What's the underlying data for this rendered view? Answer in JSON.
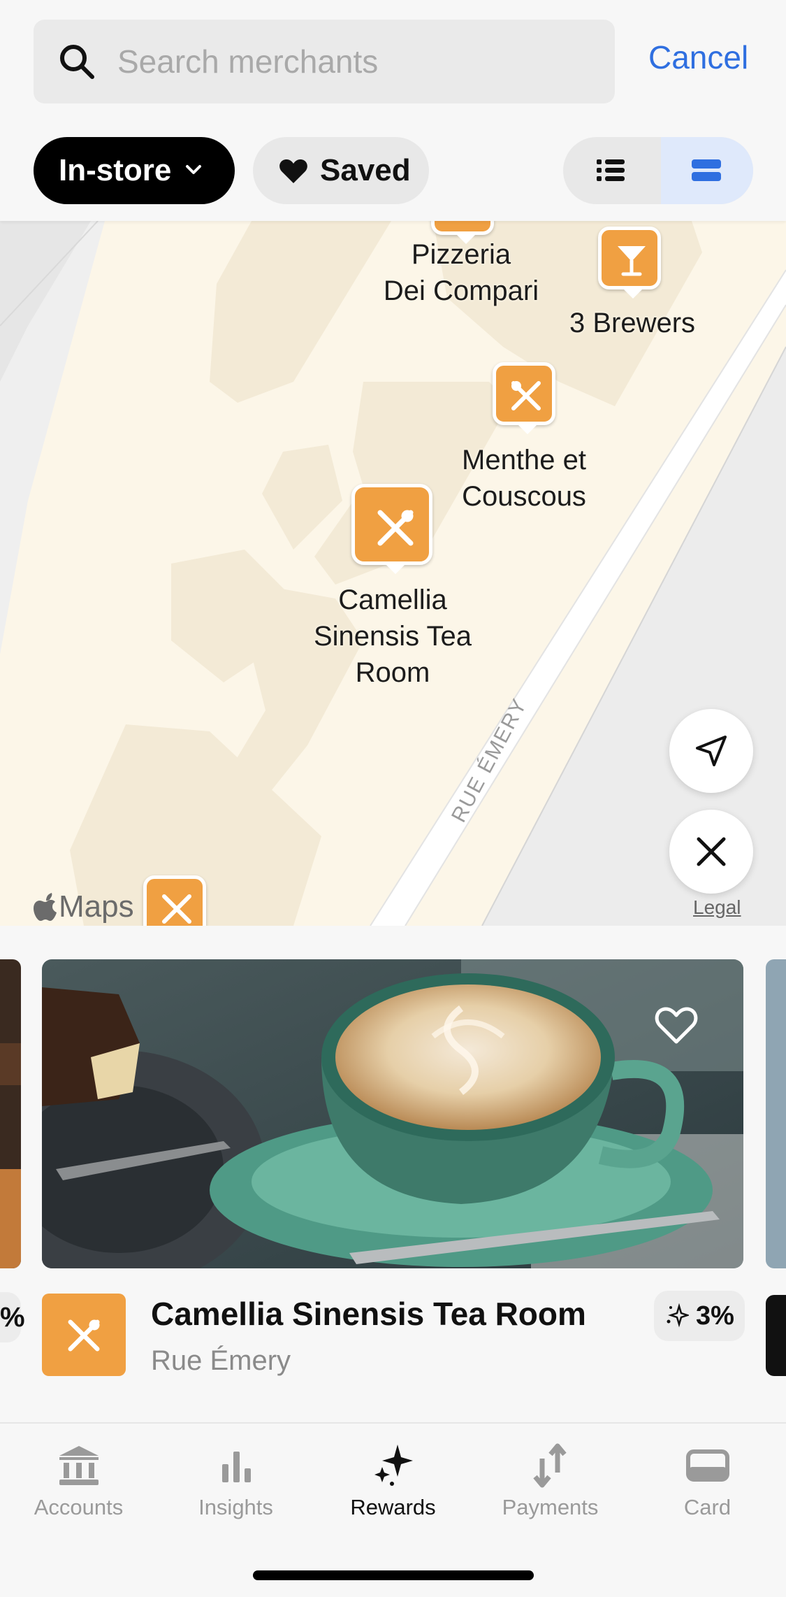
{
  "search": {
    "placeholder": "Search merchants",
    "value": "",
    "cancel_label": "Cancel"
  },
  "filters": {
    "instore_label": "In-store",
    "saved_label": "Saved",
    "view_mode": "map"
  },
  "map": {
    "pins": [
      {
        "name": "Pizzeria Dei Compari",
        "line1": "Pizzeria",
        "line2": "Dei Compari",
        "icon": "fork-knife-icon"
      },
      {
        "name": "3 Brewers",
        "line1": "3 Brewers",
        "icon": "cocktail-icon"
      },
      {
        "name": "Menthe et Couscous",
        "line1": "Menthe et",
        "line2": "Couscous",
        "icon": "fork-knife-icon"
      },
      {
        "name": "Camellia Sinensis Tea Room",
        "line1": "Camellia",
        "line2": "Sinensis Tea",
        "line3": "Room",
        "icon": "fork-knife-icon"
      }
    ],
    "street_label": "RUE ÉMERY",
    "maps_brand": "Maps",
    "legal_label": "Legal",
    "accent_color": "#f0a042"
  },
  "carousel": {
    "prev_badge": "%",
    "current": {
      "name": "Camellia Sinensis Tea Room",
      "street": "Rue Émery",
      "reward": "3%",
      "saved": false
    }
  },
  "tabs": [
    {
      "label": "Accounts",
      "icon": "bank-icon",
      "active": false
    },
    {
      "label": "Insights",
      "icon": "bar-chart-icon",
      "active": false
    },
    {
      "label": "Rewards",
      "icon": "sparkles-icon",
      "active": true
    },
    {
      "label": "Payments",
      "icon": "arrows-transfer-icon",
      "active": false
    },
    {
      "label": "Card",
      "icon": "card-icon",
      "active": false
    }
  ]
}
